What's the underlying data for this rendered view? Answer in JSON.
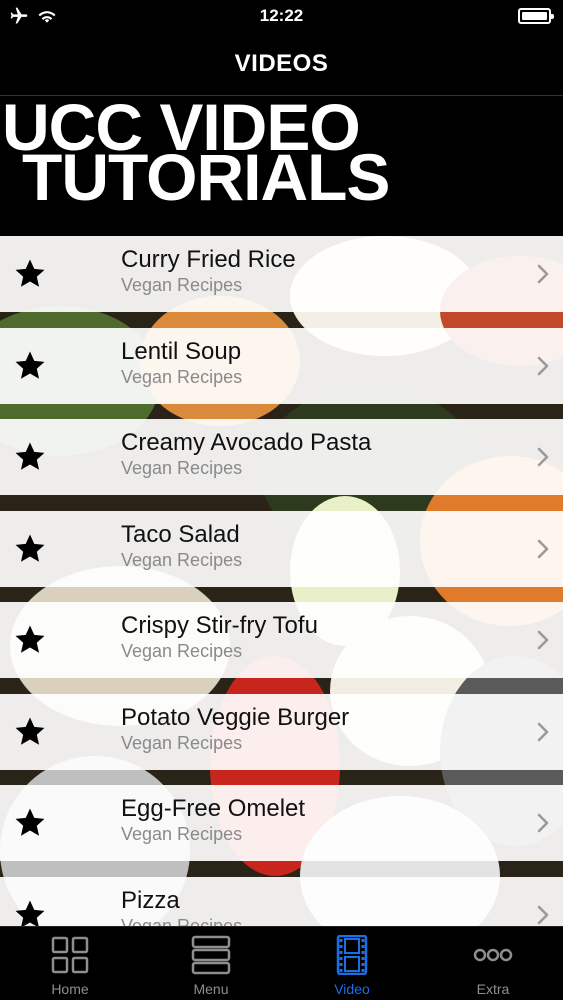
{
  "status_bar": {
    "time": "12:22",
    "icons": [
      "airplane-icon",
      "wifi-icon",
      "battery-icon"
    ]
  },
  "nav": {
    "title": "VIDEOS"
  },
  "banner": {
    "line1": "UCC VIDEO",
    "line2": "TUTORIALS"
  },
  "videos": [
    {
      "title": "Curry Fried Rice",
      "subtitle": "Vegan Recipes"
    },
    {
      "title": "Lentil Soup",
      "subtitle": "Vegan Recipes"
    },
    {
      "title": "Creamy Avocado Pasta",
      "subtitle": "Vegan Recipes"
    },
    {
      "title": "Taco Salad",
      "subtitle": "Vegan Recipes"
    },
    {
      "title": "Crispy Stir-fry Tofu",
      "subtitle": "Vegan Recipes"
    },
    {
      "title": "Potato Veggie Burger",
      "subtitle": "Vegan Recipes"
    },
    {
      "title": "Egg-Free Omelet",
      "subtitle": "Vegan Recipes"
    },
    {
      "title": "Pizza",
      "subtitle": "Vegan Recipes"
    }
  ],
  "tabs": [
    {
      "label": "Home",
      "icon": "grid-icon",
      "active": false
    },
    {
      "label": "Menu",
      "icon": "menu-icon",
      "active": false
    },
    {
      "label": "Video",
      "icon": "film-icon",
      "active": true
    },
    {
      "label": "Extra",
      "icon": "more-icon",
      "active": false
    }
  ],
  "colors": {
    "active_tab": "#1a6fe6",
    "inactive_tab": "#8e8e8e",
    "row_background": "#ffffff",
    "subtitle": "#8a8a8a"
  }
}
